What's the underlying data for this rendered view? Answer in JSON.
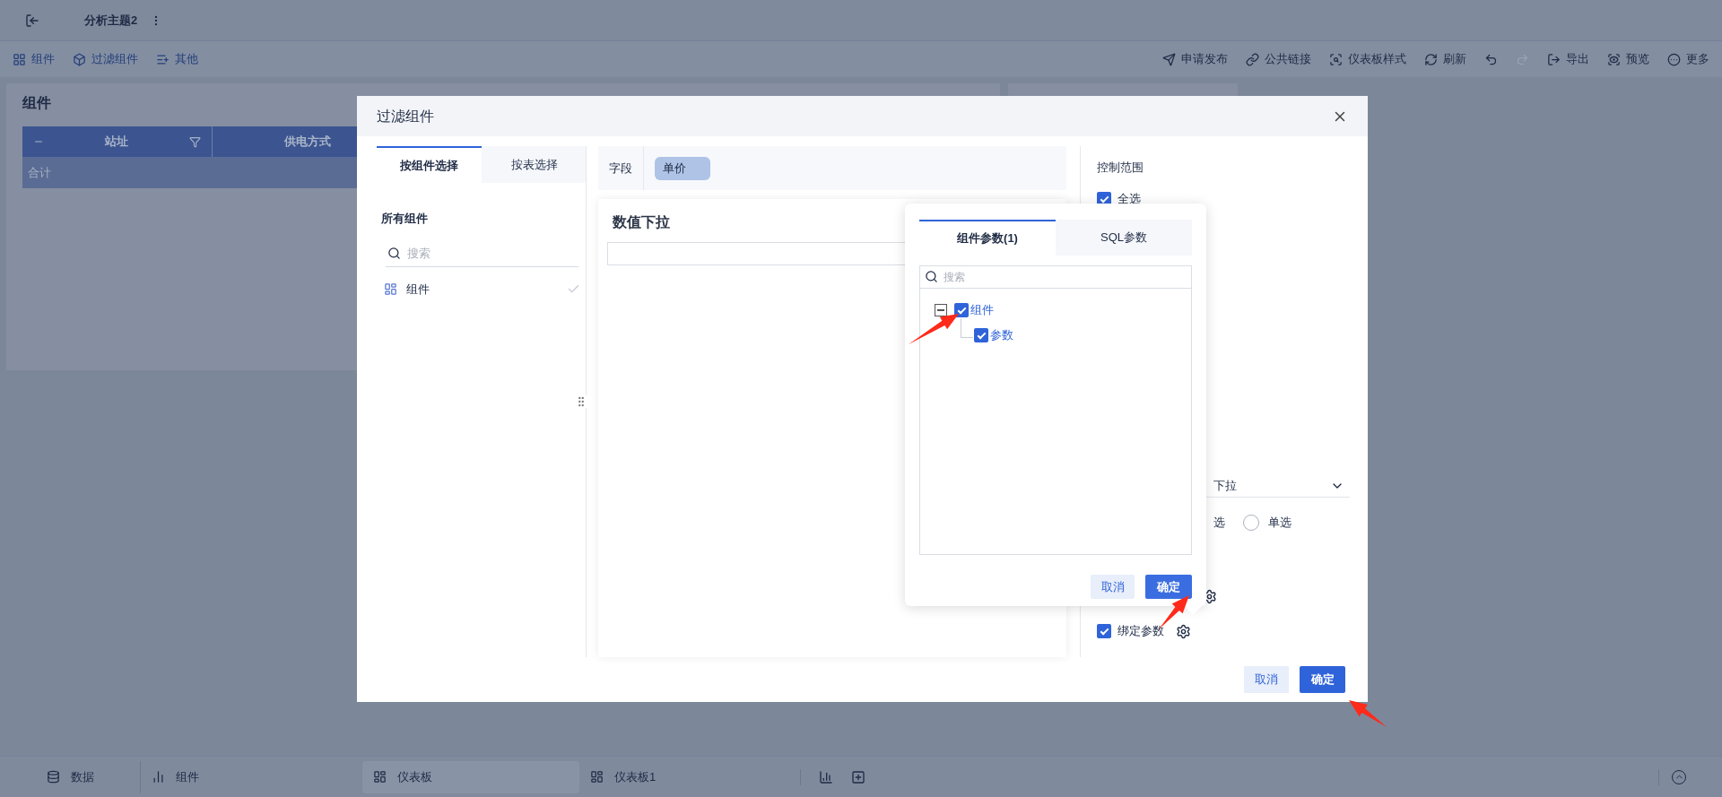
{
  "top_bar": {
    "title": "分析主题2"
  },
  "toolbar": {
    "left": [
      {
        "label": "组件"
      },
      {
        "label": "过滤组件"
      },
      {
        "label": "其他"
      }
    ],
    "right": [
      {
        "kind": "text",
        "label": "申请发布"
      },
      {
        "kind": "text",
        "label": "公共链接"
      },
      {
        "kind": "text",
        "label": "仪表板样式"
      },
      {
        "kind": "text",
        "label": "刷新"
      },
      {
        "kind": "undo",
        "disabled": false
      },
      {
        "kind": "redo",
        "disabled": true
      },
      {
        "kind": "text",
        "label": "导出"
      },
      {
        "kind": "text",
        "label": "预览"
      },
      {
        "kind": "text",
        "label": "更多"
      }
    ]
  },
  "panel": {
    "title": "组件",
    "table": {
      "columns": [
        "站址",
        "供电方式"
      ],
      "rows": [
        [
          "合计"
        ]
      ]
    }
  },
  "dialog": {
    "title": "过滤组件",
    "tabs": [
      {
        "label": "按组件选择",
        "selected": true
      },
      {
        "label": "按表选择",
        "selected": false
      }
    ],
    "components_heading": "所有组件",
    "search": {
      "placeholder": "搜索"
    },
    "components": [
      {
        "label": "组件",
        "checked": true
      }
    ],
    "field": {
      "label": "字段",
      "value": "单价"
    },
    "preview": {
      "title": "数值下拉"
    },
    "control_range": {
      "title": "控制范围",
      "select_all": {
        "label": "全选",
        "checked": true
      }
    },
    "dropdown": {
      "value": "下拉"
    },
    "mode_label": "选",
    "radios": [
      {
        "label": "单选",
        "selected": false
      }
    ],
    "bind_params": {
      "label": "绑定参数",
      "checked": true
    },
    "buttons": {
      "cancel": "取消",
      "ok": "确定"
    }
  },
  "popover": {
    "tabs": [
      {
        "label": "组件参数(1)",
        "selected": true
      },
      {
        "label": "SQL参数",
        "selected": false
      }
    ],
    "search": {
      "placeholder": "搜索"
    },
    "tree": [
      {
        "label": "组件",
        "checked": true,
        "expanded": true,
        "children": [
          {
            "label": "参数",
            "checked": true
          }
        ]
      }
    ],
    "buttons": {
      "cancel": "取消",
      "ok": "确定"
    }
  },
  "bottom_bar": {
    "tabs": [
      {
        "label": "数据",
        "selected": false
      },
      {
        "label": "组件",
        "selected": false
      },
      {
        "label": "仪表板",
        "selected": true
      },
      {
        "label": "仪表板1",
        "selected": false
      }
    ]
  }
}
